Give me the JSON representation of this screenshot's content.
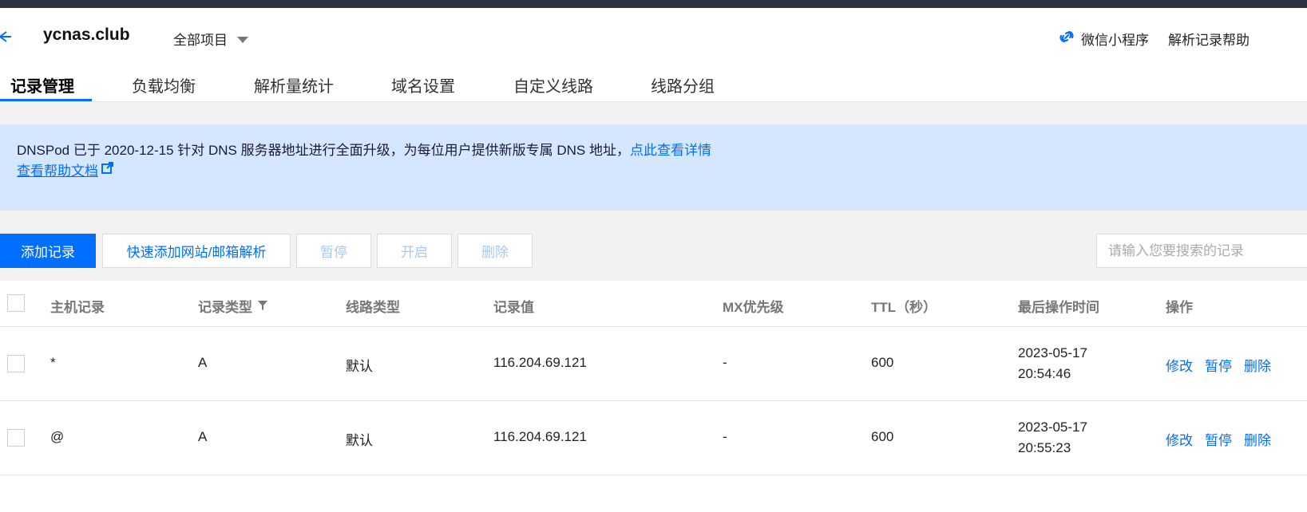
{
  "header": {
    "domain": "ycnas.club",
    "project_select": "全部项目",
    "mini_program": "微信小程序",
    "help": "解析记录帮助"
  },
  "tabs": [
    {
      "label": "记录管理",
      "active": true
    },
    {
      "label": "负载均衡"
    },
    {
      "label": "解析量统计"
    },
    {
      "label": "域名设置"
    },
    {
      "label": "自定义线路"
    },
    {
      "label": "线路分组"
    }
  ],
  "notice": {
    "text": "DNSPod 已于 2020-12-15 针对 DNS 服务器地址进行全面升级，为每位用户提供新版专属 DNS 地址，",
    "link": "点此查看详情",
    "help_doc": "查看帮助文档"
  },
  "toolbar": {
    "add": "添加记录",
    "quick_add": "快速添加网站/邮箱解析",
    "pause": "暂停",
    "enable": "开启",
    "delete": "删除",
    "search_placeholder": "请输入您要搜索的记录"
  },
  "table": {
    "columns": [
      "主机记录",
      "记录类型",
      "线路类型",
      "记录值",
      "MX优先级",
      "TTL（秒）",
      "最后操作时间",
      "操作"
    ],
    "rows": [
      {
        "host": "*",
        "type": "A",
        "line": "默认",
        "value": "116.204.69.121",
        "mx": "-",
        "ttl": "600",
        "date": "2023-05-17",
        "time": "20:54:46"
      },
      {
        "host": "@",
        "type": "A",
        "line": "默认",
        "value": "116.204.69.121",
        "mx": "-",
        "ttl": "600",
        "date": "2023-05-17",
        "time": "20:55:23"
      }
    ],
    "actions": {
      "edit": "修改",
      "pause": "暂停",
      "delete": "删除"
    }
  },
  "colors": {
    "accent": "#006eff",
    "notice_bg": "#d5e7ff",
    "topbar": "#2b3340"
  }
}
